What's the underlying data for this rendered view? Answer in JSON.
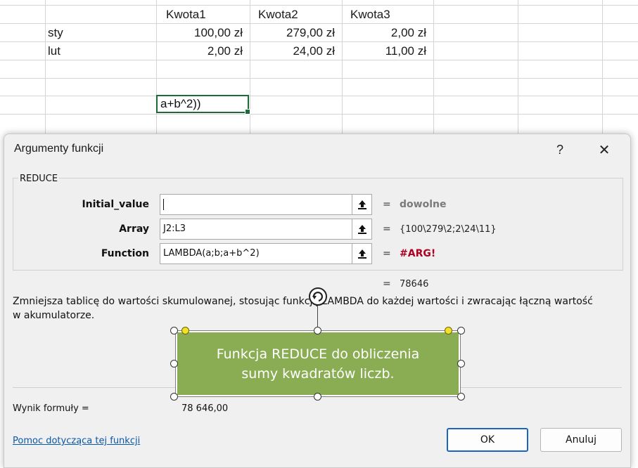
{
  "sheet": {
    "headers": [
      "Kwota1",
      "Kwota2",
      "Kwota3"
    ],
    "rows": [
      {
        "label": "sty",
        "values": [
          "100,00 zł",
          "279,00 zł",
          "2,00 zł"
        ]
      },
      {
        "label": "lut",
        "values": [
          "2,00 zł",
          "24,00 zł",
          "11,00 zł"
        ]
      }
    ],
    "active_cell_text": "a+b^2))"
  },
  "dialog": {
    "title": "Argumenty funkcji",
    "help_glyph": "?",
    "close_glyph": "✕",
    "function_name": "REDUCE",
    "args": [
      {
        "label": "Initial_value",
        "value": "",
        "result": "dowolne"
      },
      {
        "label": "Array",
        "value": "J2:L3",
        "result": "{100\\279\\2;2\\24\\11}"
      },
      {
        "label": "Function",
        "value": "LAMBDA(a;b;a+b^2)",
        "result": "#ARG!"
      }
    ],
    "equals": "=",
    "overall_result": "78646",
    "description": "Zmniejsza tablicę do wartości skumulowanej, stosując funkcję LAMBDA do każdej wartości i zwracając łączną wartość w akumulatorze.",
    "formula_result_label": "Wynik formuły =",
    "formula_result_value": "78 646,00",
    "help_link": "Pomoc dotycząca tej funkcji",
    "ok_label": "OK",
    "cancel_label": "Anuluj"
  },
  "callout": {
    "text": "Funkcja REDUCE  do obliczenia sumy kwadratów liczb.",
    "fill_color": "#8aad54"
  },
  "colors": {
    "accent": "#1b64c0",
    "error": "#b00020",
    "cell_border": "#1e6b3a"
  }
}
